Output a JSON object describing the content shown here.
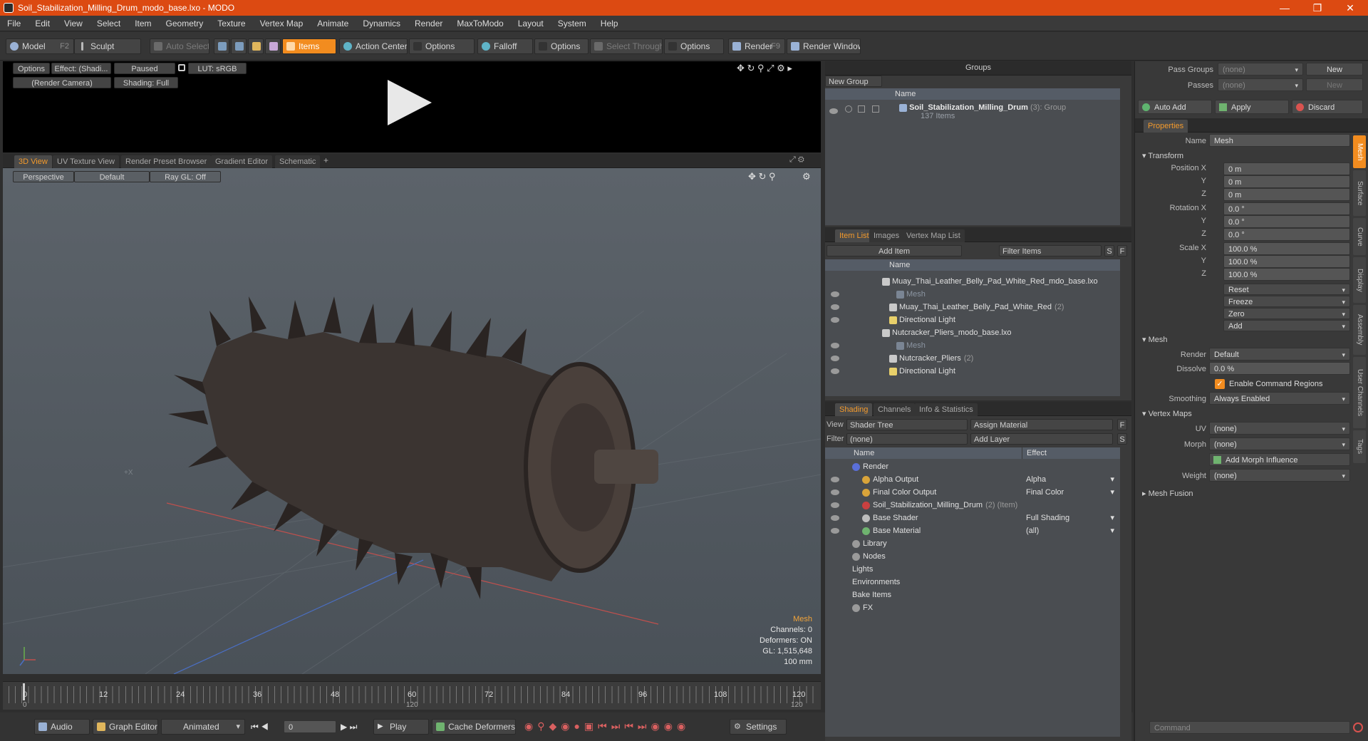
{
  "window": {
    "title": "Soil_Stabilization_Milling_Drum_modo_base.lxo - MODO"
  },
  "menu": [
    "File",
    "Edit",
    "View",
    "Select",
    "Item",
    "Geometry",
    "Texture",
    "Vertex Map",
    "Animate",
    "Dynamics",
    "Render",
    "MaxToModo",
    "Layout",
    "System",
    "Help"
  ],
  "toolbar": {
    "model": "Model",
    "model_key": "F2",
    "sculpt": "Sculpt",
    "auto_select": "Auto Select",
    "items": "Items",
    "action_center": "Action Center",
    "options1": "Options",
    "falloff": "Falloff",
    "options2": "Options",
    "select_through": "Select Through",
    "options3": "Options",
    "render": "Render",
    "render_key": "F9",
    "render_window": "Render Window"
  },
  "preview": {
    "options": "Options",
    "effect": "Effect: (Shadi...",
    "paused": "Paused",
    "lut": "LUT: sRGB",
    "camera": "(Render Camera)",
    "shading": "Shading: Full"
  },
  "viewport_tabs": [
    "3D View",
    "UV Texture View",
    "Render Preset Browser",
    "Gradient Editor",
    "Schematic"
  ],
  "viewport": {
    "perspective": "Perspective",
    "default": "Default",
    "raygl": "Ray GL: Off",
    "info": {
      "mesh": "Mesh",
      "channels": "Channels: 0",
      "deformers": "Deformers: ON",
      "gl": "GL: 1,515,648",
      "scale": "100 mm"
    },
    "axis_label": "+X"
  },
  "timeline": {
    "ticks": [
      "0",
      "12",
      "24",
      "36",
      "48",
      "60",
      "72",
      "84",
      "96",
      "108",
      "120"
    ],
    "sub_ticks": [
      "0",
      "120",
      "120"
    ]
  },
  "bottombar": {
    "audio": "Audio",
    "graph_editor": "Graph Editor",
    "animated": "Animated",
    "frame": "0",
    "play": "Play",
    "cache": "Cache Deformers",
    "settings": "Settings"
  },
  "groups": {
    "title": "Groups",
    "new_group": "New Group",
    "col_name": "Name",
    "item_name": "Soil_Stabilization_Milling_Drum",
    "item_count": "(3)",
    "item_type": ": Group",
    "item_sub": "137 Items"
  },
  "itemlist": {
    "tabs": [
      "Item List",
      "Images",
      "Vertex Map List"
    ],
    "add_item": "Add Item",
    "filter_items": "Filter Items",
    "s": "S",
    "f": "F",
    "col_name": "Name",
    "rows": [
      {
        "label": "Muay_Thai_Leather_Belly_Pad_White_Red_mdo_base.lxo",
        "extra": "",
        "indent": 0,
        "dim": false
      },
      {
        "label": "Mesh",
        "extra": "",
        "indent": 2,
        "dim": true
      },
      {
        "label": "Muay_Thai_Leather_Belly_Pad_White_Red",
        "extra": "(2)",
        "indent": 1,
        "dim": false
      },
      {
        "label": "Directional Light",
        "extra": "",
        "indent": 1,
        "dim": false
      },
      {
        "label": "Nutcracker_Pliers_modo_base.lxo",
        "extra": "",
        "indent": 0,
        "dim": false
      },
      {
        "label": "Mesh",
        "extra": "",
        "indent": 2,
        "dim": true
      },
      {
        "label": "Nutcracker_Pliers",
        "extra": "(2)",
        "indent": 1,
        "dim": false
      },
      {
        "label": "Directional Light",
        "extra": "",
        "indent": 1,
        "dim": false
      }
    ]
  },
  "shading": {
    "tabs": [
      "Shading",
      "Channels",
      "Info & Statistics"
    ],
    "view_label": "View",
    "view_value": "Shader Tree",
    "assign_material": "Assign Material",
    "f": "F",
    "filter_label": "Filter",
    "filter_value": "(none)",
    "add_layer": "Add Layer",
    "s": "S",
    "col_name": "Name",
    "col_effect": "Effect",
    "rows": [
      {
        "label": "Render",
        "extra": "",
        "effect": "",
        "indent": 0,
        "color": "#5a6fd8"
      },
      {
        "label": "Alpha Output",
        "extra": "",
        "effect": "Alpha",
        "indent": 1,
        "color": "#d9a43a"
      },
      {
        "label": "Final Color Output",
        "extra": "",
        "effect": "Final Color",
        "indent": 1,
        "color": "#d9a43a"
      },
      {
        "label": "Soil_Stabilization_Milling_Drum",
        "extra": "(2) (Item)",
        "effect": "",
        "indent": 1,
        "color": "#c94040"
      },
      {
        "label": "Base Shader",
        "extra": "",
        "effect": "Full Shading",
        "indent": 1,
        "color": "#bdbdbd"
      },
      {
        "label": "Base Material",
        "extra": "",
        "effect": "(all)",
        "indent": 1,
        "color": "#6fb36f"
      },
      {
        "label": "Library",
        "extra": "",
        "effect": "",
        "indent": 0,
        "color": "#9a9a9a"
      },
      {
        "label": "Nodes",
        "extra": "",
        "effect": "",
        "indent": 0,
        "color": "#9a9a9a"
      },
      {
        "label": "Lights",
        "extra": "",
        "effect": "",
        "indent": 0,
        "color": ""
      },
      {
        "label": "Environments",
        "extra": "",
        "effect": "",
        "indent": 0,
        "color": ""
      },
      {
        "label": "Bake Items",
        "extra": "",
        "effect": "",
        "indent": 0,
        "color": ""
      },
      {
        "label": "FX",
        "extra": "",
        "effect": "",
        "indent": 0,
        "color": "#9a9a9a"
      }
    ]
  },
  "passes": {
    "pass_groups": "Pass Groups",
    "pass_value": "(none)",
    "new": "New",
    "passes": "Passes",
    "passes_value": "(none)",
    "new2": "New"
  },
  "autoadd": {
    "auto_add": "Auto Add",
    "apply": "Apply",
    "discard": "Discard"
  },
  "properties": {
    "tab": "Properties",
    "name_label": "Name",
    "name_value": "Mesh",
    "transform": "Transform",
    "pos_labels": [
      "Position X",
      "Y",
      "Z"
    ],
    "pos_values": [
      "0 m",
      "0 m",
      "0 m"
    ],
    "rot_labels": [
      "Rotation X",
      "Y",
      "Z"
    ],
    "rot_values": [
      "0.0 °",
      "0.0 °",
      "0.0 °"
    ],
    "scale_labels": [
      "Scale X",
      "Y",
      "Z"
    ],
    "scale_values": [
      "100.0 %",
      "100.0 %",
      "100.0 %"
    ],
    "actions": [
      "Reset",
      "Freeze",
      "Zero",
      "Add"
    ],
    "mesh": "Mesh",
    "render_label": "Render",
    "render_value": "Default",
    "dissolve_label": "Dissolve",
    "dissolve_value": "0.0 %",
    "enable_cmd": "Enable Command Regions",
    "smoothing_label": "Smoothing",
    "smoothing_value": "Always Enabled",
    "vertex_maps": "Vertex Maps",
    "uv_label": "UV",
    "uv_value": "(none)",
    "morph_label": "Morph",
    "morph_value": "(none)",
    "add_morph": "Add Morph Influence",
    "weight_label": "Weight",
    "weight_value": "(none)",
    "mesh_fusion": "Mesh Fusion",
    "side_tabs": [
      "Mesh",
      "Surface",
      "Curve",
      "Display",
      "Assembly",
      "User Channels",
      "Tags"
    ],
    "command_placeholder": "Command"
  },
  "colors": {
    "accent": "#f28c1f",
    "titlebar": "#dc4a12"
  }
}
